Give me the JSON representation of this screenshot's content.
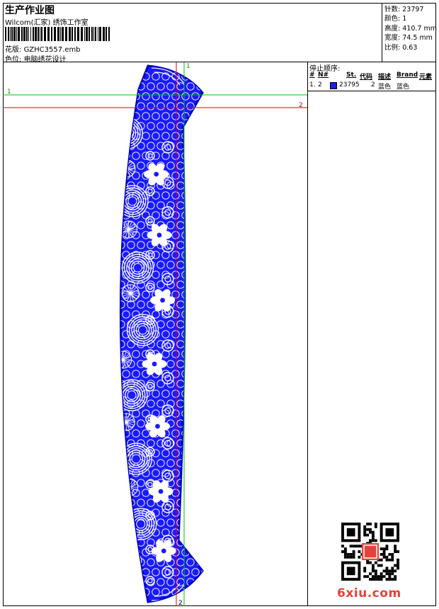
{
  "header": {
    "title": "生产作业图",
    "studio": "Wilcom(汇家) 绣饰工作室",
    "pattern_label": "花版:",
    "pattern_file": "GZHC3557.emb",
    "position_label": "色位:",
    "position_value": "电脑绣花设计"
  },
  "stats": [
    {
      "label": "针数:",
      "value": "23797"
    },
    {
      "label": "颜色:",
      "value": "1"
    },
    {
      "label": "高度:",
      "value": "410.7 mm"
    },
    {
      "label": "宽度:",
      "value": "74.5 mm"
    },
    {
      "label": "比例:",
      "value": "0.63"
    }
  ],
  "stop_sequence": {
    "title": "停止顺序:",
    "columns": [
      "#",
      "N#",
      "St.",
      "代码",
      "描述",
      "Brand",
      "元素"
    ],
    "rows": [
      {
        "index": "1.",
        "needle": "2",
        "swatch_color": "#1a1aff",
        "stitches": "23795",
        "code": "2",
        "description": "蓝色",
        "brand": "蓝色"
      }
    ]
  },
  "guides": {
    "green_v": "1",
    "green_h": "1",
    "red_h": "2",
    "red_v": "2"
  },
  "colors": {
    "thread": "#1a1aff",
    "guide_green": "#00c000",
    "guide_red": "#e00000",
    "watermark": "#e8413a"
  },
  "watermark": {
    "site": "6xiu.com"
  }
}
